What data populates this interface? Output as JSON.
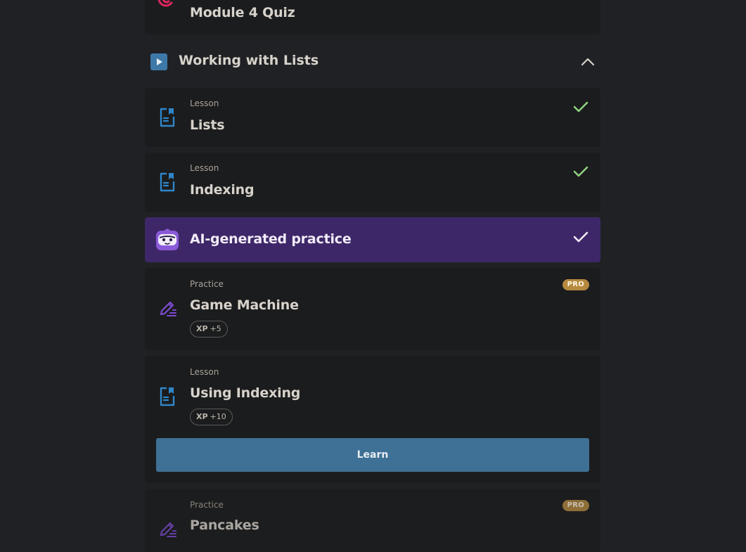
{
  "quiz": {
    "title": "Module 4 Quiz"
  },
  "section": {
    "title": "Working with Lists"
  },
  "items": [
    {
      "kind": "Lesson",
      "title": "Lists",
      "completed": true
    },
    {
      "kind": "Lesson",
      "title": "Indexing",
      "completed": true
    },
    {
      "kind": "",
      "title": "AI-generated practice",
      "completed": true
    },
    {
      "kind": "Practice",
      "title": "Game Machine",
      "badge": "PRO",
      "xp_label": "XP",
      "xp_value": "+5"
    },
    {
      "kind": "Lesson",
      "title": "Using Indexing",
      "xp_label": "XP",
      "xp_value": "+10",
      "action": "Learn"
    },
    {
      "kind": "Practice",
      "title": "Pancakes",
      "badge": "PRO"
    }
  ],
  "colors": {
    "background": "#202124",
    "card": "#1b1c1d",
    "ai_banner": "#3e2768",
    "check_green": "#8fd17f",
    "lesson_icon": "#2f86c9",
    "practice_icon": "#7d4bd0",
    "quiz_icon": "#e0265f",
    "pro_badge": "#b5893f",
    "learn_button": "#3f7095"
  },
  "icons": {
    "quiz": "quiz-target-icon",
    "section": "play-icon",
    "collapse": "chevron-up-icon",
    "lesson": "lesson-document-icon",
    "practice": "practice-pencil-icon",
    "ai": "ai-robot-icon",
    "done": "checkmark-icon"
  }
}
